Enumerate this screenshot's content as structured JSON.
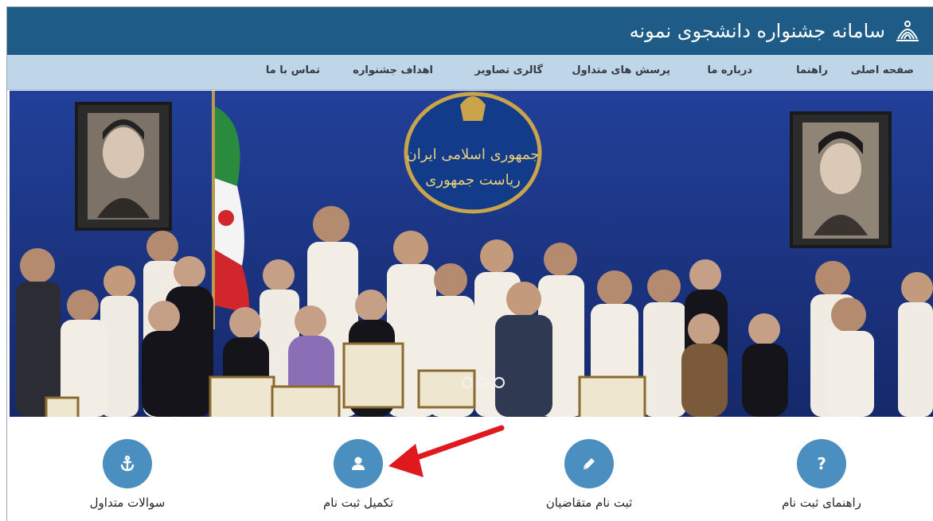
{
  "header": {
    "title": "سامانه جشنواره دانشجوی نمونه",
    "logo_icon": "university-logo-icon",
    "background": "#1e5b86"
  },
  "nav": {
    "items": [
      {
        "label": "صفحه اصلی"
      },
      {
        "label": "راهنما"
      },
      {
        "label": "درباره ما"
      },
      {
        "label": "پرسش های متداول"
      },
      {
        "label": "گالری تصاویر"
      },
      {
        "label": "اهداف جشنواره"
      },
      {
        "label": "تماس با ما"
      }
    ]
  },
  "slider": {
    "emblem_line1": "جمهوری اسلامی ایران",
    "emblem_line2": "ریاست جمهوری",
    "dot_count": 3
  },
  "features": [
    {
      "label": "راهنمای ثبت نام",
      "icon": "question-icon"
    },
    {
      "label": "ثبت نام متقاضیان",
      "icon": "pencil-icon"
    },
    {
      "label": "تکمیل ثبت نام",
      "icon": "user-icon"
    },
    {
      "label": "سوالات متداول",
      "icon": "anchor-icon"
    }
  ],
  "colors": {
    "accent": "#4a8fc0",
    "nav_bg": "#bfd6e8",
    "annotation_arrow": "#e0191f"
  }
}
